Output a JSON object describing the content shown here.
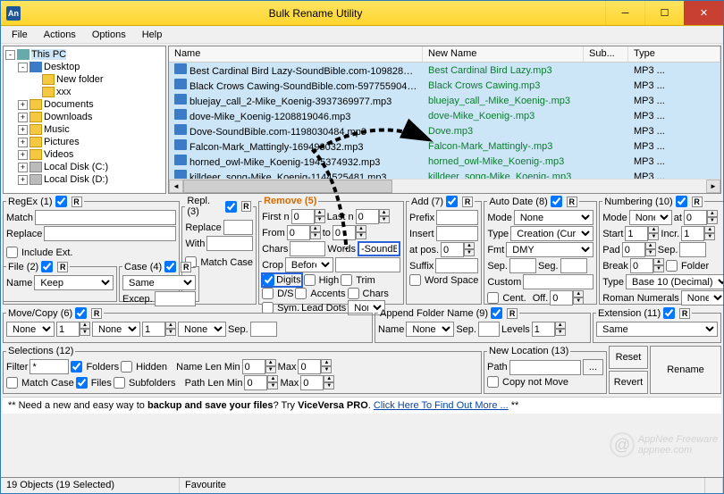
{
  "window": {
    "title": "Bulk Rename Utility",
    "icon_text": "An"
  },
  "menu": [
    "File",
    "Actions",
    "Options",
    "Help"
  ],
  "tree": [
    {
      "depth": 0,
      "exp": "-",
      "icon": "pc",
      "label": "This PC",
      "sel": true
    },
    {
      "depth": 1,
      "exp": "-",
      "icon": "desk",
      "label": "Desktop"
    },
    {
      "depth": 2,
      "exp": " ",
      "icon": "fold",
      "label": "New folder"
    },
    {
      "depth": 2,
      "exp": " ",
      "icon": "fold",
      "label": "xxx"
    },
    {
      "depth": 1,
      "exp": "+",
      "icon": "fold",
      "label": "Documents"
    },
    {
      "depth": 1,
      "exp": "+",
      "icon": "fold",
      "label": "Downloads"
    },
    {
      "depth": 1,
      "exp": "+",
      "icon": "fold",
      "label": "Music"
    },
    {
      "depth": 1,
      "exp": "+",
      "icon": "fold",
      "label": "Pictures"
    },
    {
      "depth": 1,
      "exp": "+",
      "icon": "fold",
      "label": "Videos"
    },
    {
      "depth": 1,
      "exp": "+",
      "icon": "drive",
      "label": "Local Disk (C:)"
    },
    {
      "depth": 1,
      "exp": "+",
      "icon": "drive",
      "label": "Local Disk (D:)"
    }
  ],
  "cols": {
    "name": "Name",
    "new": "New Name",
    "sub": "Sub...",
    "type": "Type"
  },
  "files": [
    {
      "name": "Best Cardinal Bird Lazy-SoundBible.com-1098288881...",
      "new": "Best Cardinal Bird Lazy.mp3",
      "type": "MP3 ..."
    },
    {
      "name": "Black Crows Cawing-SoundBible.com-597755904.mp3",
      "new": "Black Crows Cawing.mp3",
      "type": "MP3 ..."
    },
    {
      "name": "bluejay_call_2-Mike_Koenig-3937369977.mp3",
      "new": "bluejay_call_-Mike_Koenig-.mp3",
      "type": "MP3 ..."
    },
    {
      "name": "dove-Mike_Koenig-1208819046.mp3",
      "new": "dove-Mike_Koenig-.mp3",
      "type": "MP3 ..."
    },
    {
      "name": "Dove-SoundBible.com-1198030484.mp3",
      "new": "Dove.mp3",
      "type": "MP3 ..."
    },
    {
      "name": "Falcon-Mark_Mattingly-169493032.mp3",
      "new": "Falcon-Mark_Mattingly-.mp3",
      "type": "MP3 ..."
    },
    {
      "name": "horned_owl-Mike_Koenig-1945374932.mp3",
      "new": "horned_owl-Mike_Koenig-.mp3",
      "type": "MP3 ..."
    },
    {
      "name": "killdeer_song-Mike_Koenig-1144525481.mp3",
      "new": "killdeer_song-Mike_Koenig-.mp3",
      "type": "MP3 ..."
    }
  ],
  "regex": {
    "legend": "RegEx (1)",
    "match": "Match",
    "replace": "Replace",
    "include": "Include Ext."
  },
  "file2": {
    "legend": "File (2)",
    "name": "Name",
    "opt": "Keep"
  },
  "repl": {
    "legend": "Repl. (3)",
    "replace": "Replace",
    "with": "With",
    "matchcase": "Match Case"
  },
  "case4": {
    "legend": "Case (4)",
    "same": "Same",
    "excep": "Excep."
  },
  "remove": {
    "legend": "Remove (5)",
    "firstn": "First n",
    "lastn": "Last n",
    "from": "From",
    "to": "to",
    "chars": "Chars",
    "words": "Words",
    "words_val": "-SoundB",
    "crop": "Crop",
    "crop_opt": "Before",
    "digits": "Digits",
    "high": "High",
    "trim": "Trim",
    "ds": "D/S",
    "accents": "Accents",
    "chars2": "Chars",
    "sym": "Sym.",
    "leaddots": "Lead Dots",
    "leaddots_opt": "Non"
  },
  "add": {
    "legend": "Add (7)",
    "prefix": "Prefix",
    "insert": "Insert",
    "atpos": "at pos.",
    "suffix": "Suffix",
    "wordspace": "Word Space"
  },
  "autodate": {
    "legend": "Auto Date (8)",
    "mode": "Mode",
    "mode_v": "None",
    "type": "Type",
    "type_v": "Creation (Cur",
    "fmt": "Fmt",
    "fmt_v": "DMY",
    "sep": "Sep.",
    "seg": "Seg.",
    "custom": "Custom",
    "cent": "Cent.",
    "off": "Off."
  },
  "numbering": {
    "legend": "Numbering (10)",
    "mode": "Mode",
    "mode_v": "None",
    "at": "at",
    "start": "Start",
    "incr": "Incr.",
    "pad": "Pad",
    "sep": "Sep.",
    "break": "Break",
    "folder": "Folder",
    "type": "Type",
    "type_v": "Base 10 (Decimal)",
    "roman": "Roman Numerals",
    "roman_v": "None"
  },
  "movecopy": {
    "legend": "Move/Copy (6)",
    "none": "None",
    "sep": "Sep."
  },
  "appendfolder": {
    "legend": "Append Folder Name (9)",
    "name": "Name",
    "none": "None",
    "sep": "Sep.",
    "levels": "Levels"
  },
  "ext": {
    "legend": "Extension (11)",
    "same": "Same"
  },
  "selections": {
    "legend": "Selections (12)",
    "filter": "Filter",
    "filter_v": "*",
    "folders": "Folders",
    "hidden": "Hidden",
    "matchcase": "Match Case",
    "files": "Files",
    "subfolders": "Subfolders",
    "namemin": "Name Len Min",
    "pathmin": "Path Len Min",
    "max": "Max"
  },
  "newloc": {
    "legend": "New Location (13)",
    "path": "Path",
    "copynot": "Copy not Move"
  },
  "btns": {
    "reset": "Reset",
    "revert": "Revert",
    "rename": "Rename"
  },
  "footer": {
    "pre": "** Need a new and easy way to ",
    "bold": "backup and save your files",
    "mid": "? Try ",
    "prod": "ViceVersa PRO",
    "post": ". ",
    "link": "Click Here To Find Out More ...",
    "end": " **"
  },
  "status": {
    "left": "19 Objects (19 Selected)",
    "mid": "Favourite"
  },
  "watermark": "AppNee Freeware\n appnee.com"
}
